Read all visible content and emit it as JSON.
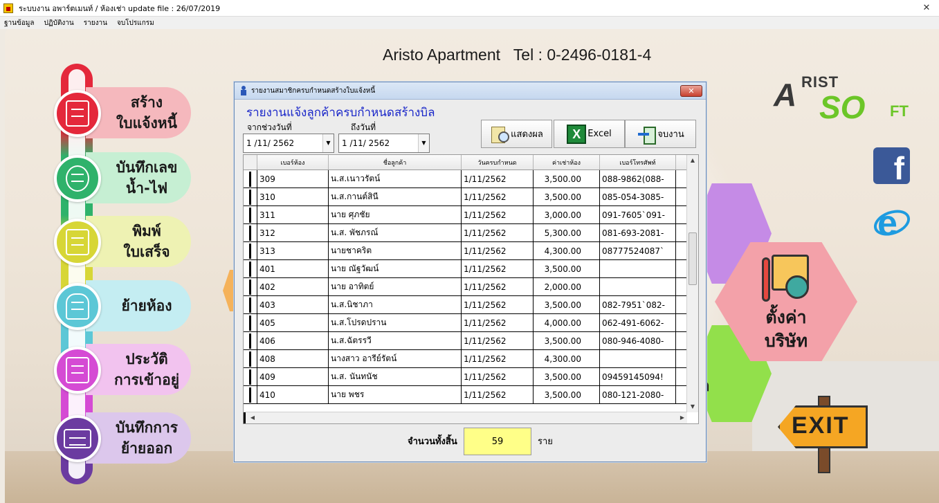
{
  "window": {
    "title": "ระบบงาน อพาร์ตเมนท์ / ห้องเช่า update file : 26/07/2019",
    "close_label": "✕"
  },
  "menubar": [
    "ฐานข้อมูล",
    "ปฏิบัติงาน",
    "รายงาน",
    "จบโปรแกรม"
  ],
  "header": {
    "company": "Aristo Apartment   Tel : 0-2496-0181-4"
  },
  "left_menu": [
    {
      "label": "สร้าง ใบแจ้งหนี้",
      "line1": "สร้าง",
      "line2": "ใบแจ้งหนี้",
      "icon": "invoice-icon",
      "color": "#e4283b",
      "pill_color": "#f5b8bd"
    },
    {
      "label": "บันทึกเลข น้ำ-ไฟ",
      "line1": "บันทึกเลข",
      "line2": "น้ำ-ไฟ",
      "icon": "meter-icon",
      "color": "#2fb26b",
      "pill_color": "#c6efd3"
    },
    {
      "label": "พิมพ์ ใบเสร็จ",
      "line1": "พิมพ์",
      "line2": "ใบเสร็จ",
      "icon": "receipt-icon",
      "color": "#d7d636",
      "pill_color": "#eef2b3"
    },
    {
      "label": "ย้ายห้อง",
      "line1": "ย้ายห้อง",
      "line2": "",
      "icon": "move-room-icon",
      "color": "#5cc7d6",
      "pill_color": "#c4edf2"
    },
    {
      "label": "ประวัติ การเข้าอยู่",
      "line1": "ประวัติ",
      "line2": "การเข้าอยู่",
      "icon": "history-icon",
      "color": "#d54bd4",
      "pill_color": "#f2c3ef"
    },
    {
      "label": "บันทึกการ ย้ายออก",
      "line1": "บันทึกการ",
      "line2": "ย้ายออก",
      "icon": "moving-truck-icon",
      "color": "#6b3ba0",
      "pill_color": "#dcc7ec"
    }
  ],
  "right": {
    "logo": {
      "a": "A",
      "rist": "RIST",
      "so": "SO",
      "ft": "FT"
    },
    "facebook": "f",
    "ie": "e",
    "settings_line1": "ตั้งค่า",
    "settings_line2": "บริษัท",
    "exit_label": "EXIT",
    "partial_text_1": ":",
    "partial_text_2": "ก"
  },
  "dialog": {
    "title": "รายงานสมาชิกครบกำหนดสร้างใบแจ้งหนี้",
    "close": "✕",
    "heading": "รายงานแจ้งลูกค้าครบกำหนดสร้างบิล",
    "from_label": "จากช่วงวันที่",
    "to_label": "ถึงวันที่",
    "from_value": "1 /11/ 2562",
    "to_value": "1 /11/ 2562",
    "buttons": {
      "show": "แสดงผล",
      "excel": "Excel",
      "exit": "จบงาน"
    },
    "columns": [
      "เบอร์ห้อง",
      "ชื่อลูกค้า",
      "วันครบกำหนด",
      "ค่าเช่าห้อง",
      "เบอร์โทรศัพท์"
    ],
    "rows": [
      [
        "309",
        "น.ส.เนาวรัตน์",
        "1/11/2562",
        "3,500.00",
        "088-9862(088-"
      ],
      [
        "310",
        "น.ส.กานต์สินี",
        "1/11/2562",
        "3,500.00",
        "085-054-3085-"
      ],
      [
        "311",
        "นาย ศุภชัย",
        "1/11/2562",
        "3,000.00",
        "091-7605`091-"
      ],
      [
        "312",
        "น.ส. พัชภรณ์",
        "1/11/2562",
        "5,300.00",
        "081-693-2081-"
      ],
      [
        "313",
        "นายชาคริต",
        "1/11/2562",
        "4,300.00",
        "08777524087`"
      ],
      [
        "401",
        "นาย ณัฐวัฒน์",
        "1/11/2562",
        "3,500.00",
        ""
      ],
      [
        "402",
        "นาย อาทิตย์",
        "1/11/2562",
        "2,000.00",
        ""
      ],
      [
        "403",
        "น.ส.นิชาภา",
        "1/11/2562",
        "3,500.00",
        "082-7951`082-"
      ],
      [
        "405",
        "น.ส.โปรดปราน",
        "1/11/2562",
        "4,000.00",
        "062-491-6062-"
      ],
      [
        "406",
        "น.ส.ฉัตรรวี",
        "1/11/2562",
        "3,500.00",
        "080-946-4080-"
      ],
      [
        "408",
        "นางสาว อารีย์รัตน์",
        "1/11/2562",
        "4,300.00",
        ""
      ],
      [
        "409",
        "น.ส. นันทนัช",
        "1/11/2562",
        "3,500.00",
        "09459145094!"
      ],
      [
        "410",
        "นาย พชร",
        "1/11/2562",
        "3,500.00",
        "080-121-2080-"
      ]
    ],
    "total_label": "จำนวนทั้งสิ้น",
    "total_value": "59",
    "total_unit": "ราย"
  }
}
